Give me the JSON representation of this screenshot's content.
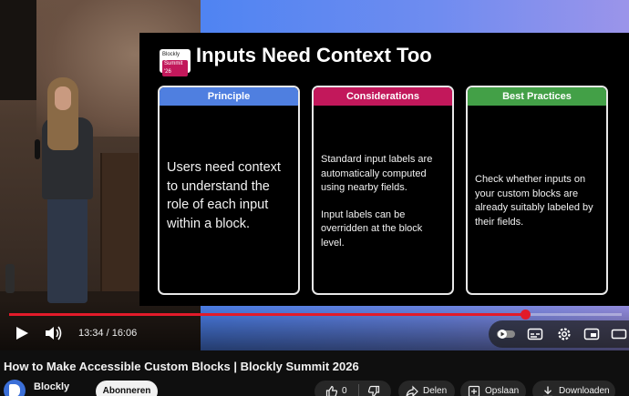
{
  "slide": {
    "badge_line1": "Blockly",
    "badge_line2": "Summit '26",
    "title": "Inputs Need Context Too",
    "cards": [
      {
        "heading": "Principle",
        "body": [
          "Users need context to understand the role of each input within a block."
        ]
      },
      {
        "heading": "Considerations",
        "body": [
          "Standard input labels are automatically computed using nearby fields.",
          "Input labels can be overridden at the block level."
        ]
      },
      {
        "heading": "Best Practices",
        "body": [
          "Check whether inputs on your custom blocks are already suitably labeled by their fields."
        ]
      }
    ]
  },
  "player": {
    "current_time": "13:34",
    "duration": "16:06",
    "time_display": "13:34 / 16:06",
    "progress_fraction": 0.843,
    "accent_color": "#e21b2a",
    "icons": [
      "play-icon",
      "volume-icon",
      "autoplay-toggle-icon",
      "subtitles-icon",
      "settings-icon",
      "miniplayer-icon",
      "theater-icon"
    ]
  },
  "video": {
    "title": "How to Make Accessible Custom Blocks | Blockly Summit 2026"
  },
  "channel": {
    "name": "Blockly",
    "subscribe_label": "Abonneren"
  },
  "actions": {
    "like_count": "0",
    "share_label": "Delen",
    "save_label": "Opslaan",
    "download_label": "Downloaden"
  }
}
